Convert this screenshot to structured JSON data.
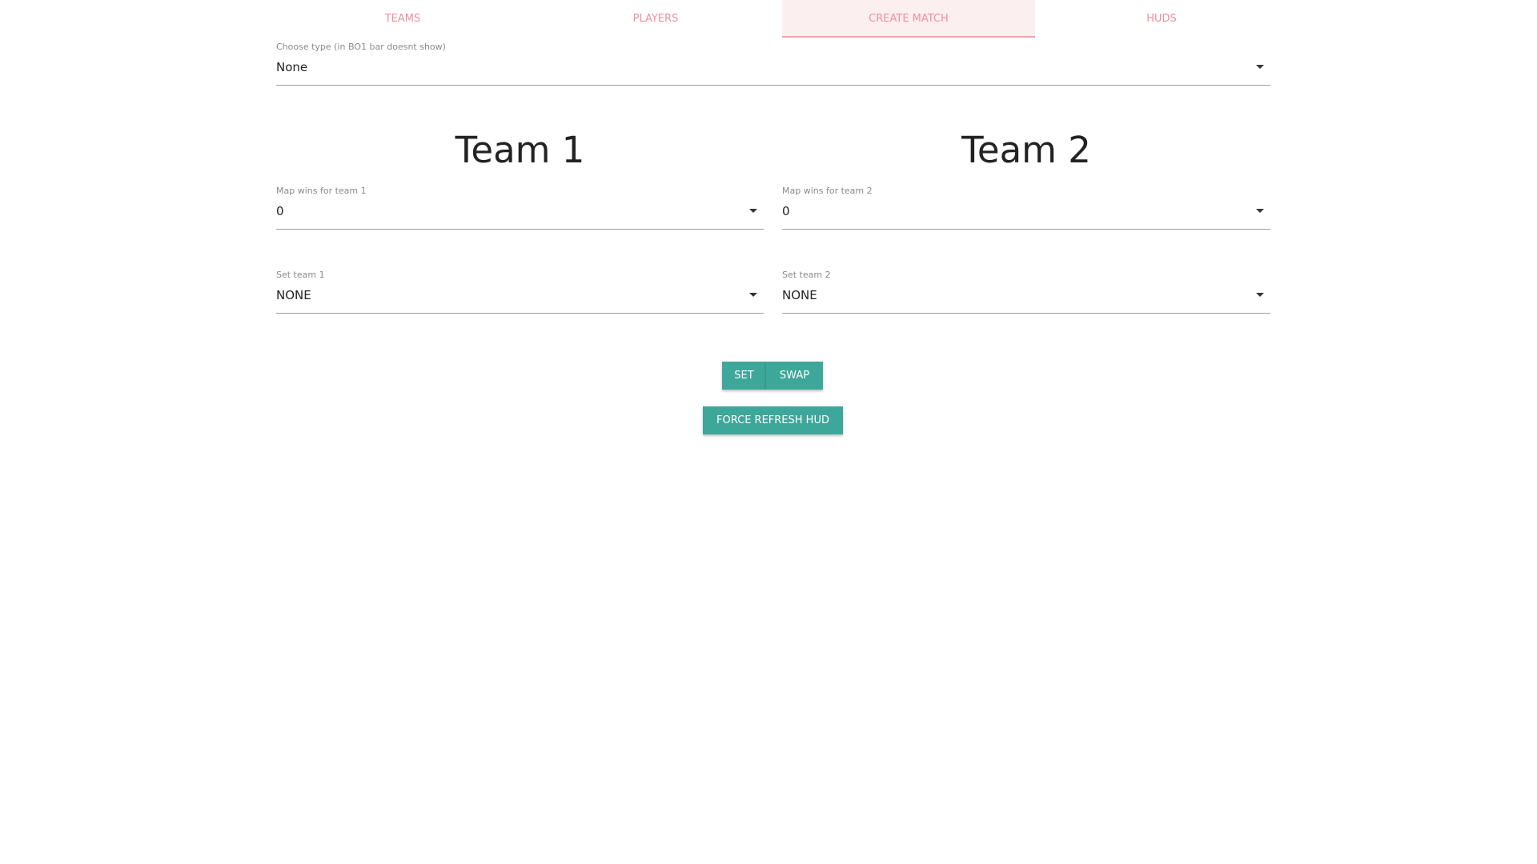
{
  "tabs": [
    {
      "label": "TEAMS"
    },
    {
      "label": "PLAYERS"
    },
    {
      "label": "CREATE MATCH"
    },
    {
      "label": "HUDS"
    }
  ],
  "active_tab": "CREATE MATCH",
  "match_type": {
    "label": "Choose type (in BO1 bar doesnt show)",
    "value": "None"
  },
  "team1": {
    "title": "Team 1",
    "map_wins_label": "Map wins for team 1",
    "map_wins_value": "0",
    "set_team_label": "Set team 1",
    "set_team_value": "NONE"
  },
  "team2": {
    "title": "Team 2",
    "map_wins_label": "Map wins for team 2",
    "map_wins_value": "0",
    "set_team_label": "Set team 2",
    "set_team_value": "NONE"
  },
  "buttons": {
    "set": "SET",
    "swap": "SWAP",
    "force_refresh": "FORCE REFRESH HUD"
  },
  "colors": {
    "tab_text": "#ef8f9d",
    "tab_active_bg": "#fcefef",
    "button_bg": "#3da79a"
  }
}
